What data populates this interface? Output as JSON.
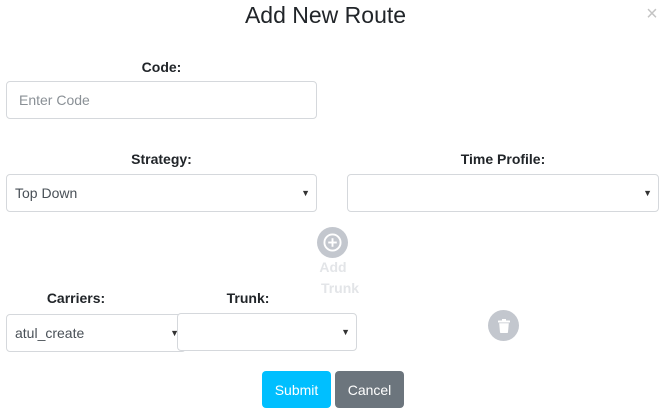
{
  "dialog": {
    "title": "Add New Route",
    "close_glyph": "×"
  },
  "code": {
    "label": "Code:",
    "placeholder": "Enter Code",
    "value": ""
  },
  "strategy": {
    "label": "Strategy:",
    "selected": "Top Down"
  },
  "time_profile": {
    "label": "Time Profile:",
    "selected": ""
  },
  "add_trunk": {
    "label_line1": "Add",
    "label_line2": "Trunk",
    "icon": "plus-circle-icon"
  },
  "carriers": {
    "label": "Carriers:",
    "selected": "atul_create"
  },
  "trunk": {
    "label": "Trunk:",
    "selected": ""
  },
  "delete": {
    "icon": "trash-icon"
  },
  "actions": {
    "submit_label": "Submit",
    "cancel_label": "Cancel"
  },
  "colors": {
    "submit": "#00bfff",
    "cancel": "#6c757d",
    "icon_circle": "#c3c7ce"
  }
}
